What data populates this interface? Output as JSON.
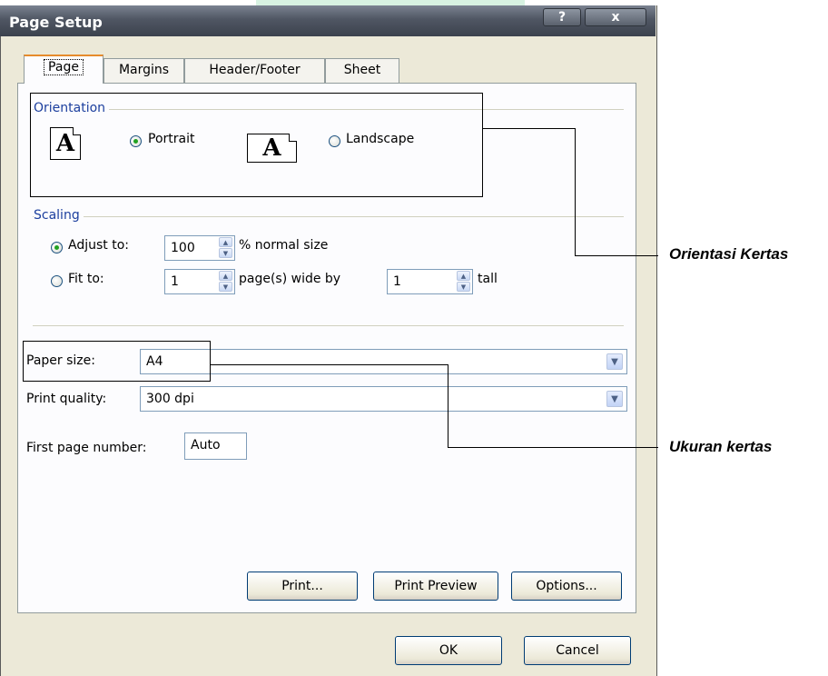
{
  "window": {
    "title": "Page Setup",
    "help_label": "?",
    "close_label": "x"
  },
  "tabs": [
    {
      "label": "Page",
      "active": true
    },
    {
      "label": "Margins",
      "active": false
    },
    {
      "label": "Header/Footer",
      "active": false
    },
    {
      "label": "Sheet",
      "active": false
    }
  ],
  "orientation": {
    "group_label": "Orientation",
    "portrait_label": "Portrait",
    "landscape_label": "Landscape",
    "selected": "portrait",
    "icon_glyph": "A"
  },
  "scaling": {
    "group_label": "Scaling",
    "adjust_label": "Adjust to:",
    "adjust_value": "100",
    "adjust_suffix": "% normal size",
    "fit_label": "Fit to:",
    "fit_wide_value": "1",
    "fit_wide_suffix": "page(s) wide by",
    "fit_tall_value": "1",
    "fit_tall_suffix": "tall",
    "selected": "adjust"
  },
  "paper_size": {
    "label": "Paper size:",
    "value": "A4"
  },
  "print_quality": {
    "label": "Print quality:",
    "value": "300 dpi"
  },
  "first_page_number": {
    "label": "First page number:",
    "value": "Auto"
  },
  "buttons": {
    "print": "Print...",
    "print_preview": "Print Preview",
    "options": "Options...",
    "ok": "OK",
    "cancel": "Cancel"
  },
  "annotations": {
    "orientation": "Orientasi Kertas",
    "paper_size": "Ukuran kertas"
  },
  "colors": {
    "group_label": "#1c3f9e",
    "active_tab_accent": "#e68b2c",
    "radio_selected": "#21a121",
    "title_bar": "#4f5663"
  }
}
